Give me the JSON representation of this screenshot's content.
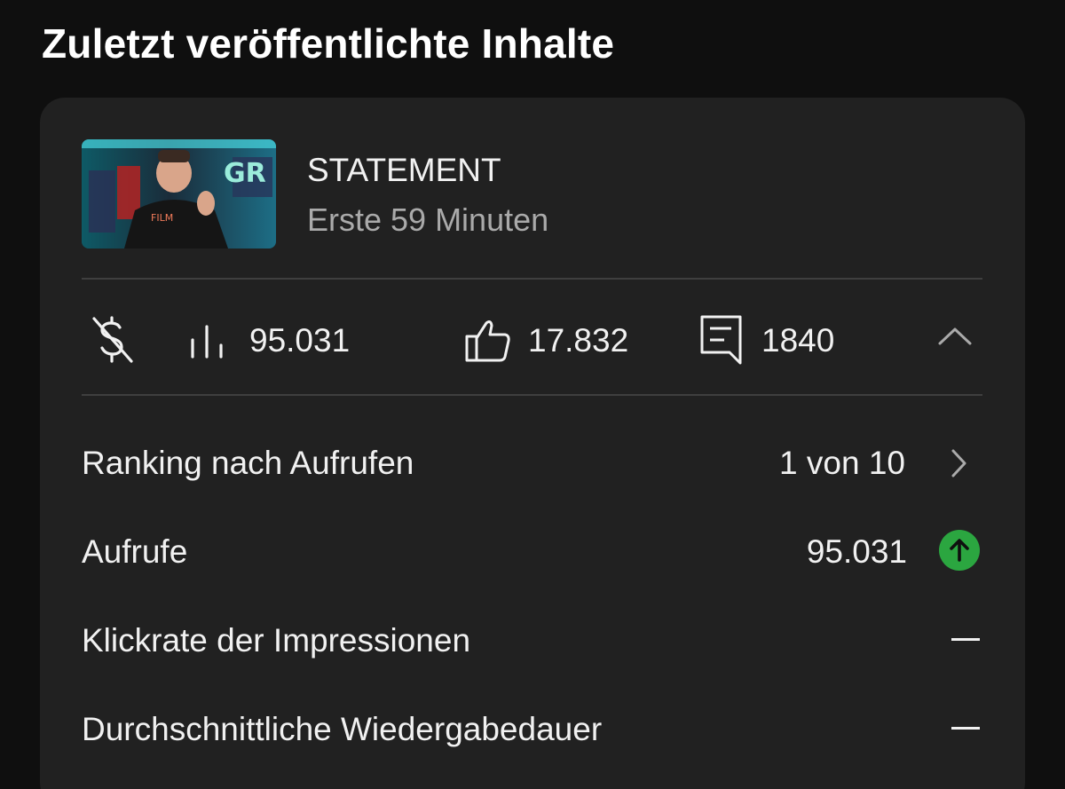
{
  "section": {
    "title": "Zuletzt veröffentlichte Inhalte"
  },
  "video": {
    "thumbnail_icon": "video-thumbnail",
    "thumbnail_text": "FILM",
    "title": "STATEMENT",
    "subtitle": "Erste 59 Minuten"
  },
  "stats": {
    "monetization_icon": "monetization-off-icon",
    "views_icon": "bar-chart-icon",
    "views": "95.031",
    "likes_icon": "thumb-up-icon",
    "likes": "17.832",
    "comments_icon": "comment-icon",
    "comments": "1840",
    "collapse_icon": "chevron-up-icon"
  },
  "metrics": [
    {
      "label": "Ranking nach Aufrufen",
      "value": "1 von 10",
      "icon": "chevron-right-icon"
    },
    {
      "label": "Aufrufe",
      "value": "95.031",
      "icon": "arrow-up-circle-icon"
    },
    {
      "label": "Klickrate der Impressionen",
      "value": "—"
    },
    {
      "label": "Durchschnittliche Wiedergabedauer",
      "value": "—"
    }
  ],
  "colors": {
    "background": "#0f0f0f",
    "card": "#212121",
    "text": "#f1f1f1",
    "secondary_text": "#aaaaaa",
    "accent_green": "#2ba640"
  }
}
